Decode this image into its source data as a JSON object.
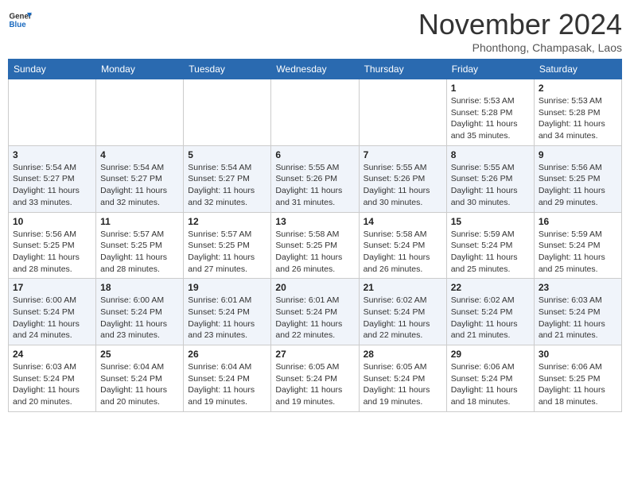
{
  "header": {
    "logo_line1": "General",
    "logo_line2": "Blue",
    "month": "November 2024",
    "location": "Phonthong, Champasak, Laos"
  },
  "days_of_week": [
    "Sunday",
    "Monday",
    "Tuesday",
    "Wednesday",
    "Thursday",
    "Friday",
    "Saturday"
  ],
  "weeks": [
    [
      {
        "day": "",
        "info": ""
      },
      {
        "day": "",
        "info": ""
      },
      {
        "day": "",
        "info": ""
      },
      {
        "day": "",
        "info": ""
      },
      {
        "day": "",
        "info": ""
      },
      {
        "day": "1",
        "info": "Sunrise: 5:53 AM\nSunset: 5:28 PM\nDaylight: 11 hours\nand 35 minutes."
      },
      {
        "day": "2",
        "info": "Sunrise: 5:53 AM\nSunset: 5:28 PM\nDaylight: 11 hours\nand 34 minutes."
      }
    ],
    [
      {
        "day": "3",
        "info": "Sunrise: 5:54 AM\nSunset: 5:27 PM\nDaylight: 11 hours\nand 33 minutes."
      },
      {
        "day": "4",
        "info": "Sunrise: 5:54 AM\nSunset: 5:27 PM\nDaylight: 11 hours\nand 32 minutes."
      },
      {
        "day": "5",
        "info": "Sunrise: 5:54 AM\nSunset: 5:27 PM\nDaylight: 11 hours\nand 32 minutes."
      },
      {
        "day": "6",
        "info": "Sunrise: 5:55 AM\nSunset: 5:26 PM\nDaylight: 11 hours\nand 31 minutes."
      },
      {
        "day": "7",
        "info": "Sunrise: 5:55 AM\nSunset: 5:26 PM\nDaylight: 11 hours\nand 30 minutes."
      },
      {
        "day": "8",
        "info": "Sunrise: 5:55 AM\nSunset: 5:26 PM\nDaylight: 11 hours\nand 30 minutes."
      },
      {
        "day": "9",
        "info": "Sunrise: 5:56 AM\nSunset: 5:25 PM\nDaylight: 11 hours\nand 29 minutes."
      }
    ],
    [
      {
        "day": "10",
        "info": "Sunrise: 5:56 AM\nSunset: 5:25 PM\nDaylight: 11 hours\nand 28 minutes."
      },
      {
        "day": "11",
        "info": "Sunrise: 5:57 AM\nSunset: 5:25 PM\nDaylight: 11 hours\nand 28 minutes."
      },
      {
        "day": "12",
        "info": "Sunrise: 5:57 AM\nSunset: 5:25 PM\nDaylight: 11 hours\nand 27 minutes."
      },
      {
        "day": "13",
        "info": "Sunrise: 5:58 AM\nSunset: 5:25 PM\nDaylight: 11 hours\nand 26 minutes."
      },
      {
        "day": "14",
        "info": "Sunrise: 5:58 AM\nSunset: 5:24 PM\nDaylight: 11 hours\nand 26 minutes."
      },
      {
        "day": "15",
        "info": "Sunrise: 5:59 AM\nSunset: 5:24 PM\nDaylight: 11 hours\nand 25 minutes."
      },
      {
        "day": "16",
        "info": "Sunrise: 5:59 AM\nSunset: 5:24 PM\nDaylight: 11 hours\nand 25 minutes."
      }
    ],
    [
      {
        "day": "17",
        "info": "Sunrise: 6:00 AM\nSunset: 5:24 PM\nDaylight: 11 hours\nand 24 minutes."
      },
      {
        "day": "18",
        "info": "Sunrise: 6:00 AM\nSunset: 5:24 PM\nDaylight: 11 hours\nand 23 minutes."
      },
      {
        "day": "19",
        "info": "Sunrise: 6:01 AM\nSunset: 5:24 PM\nDaylight: 11 hours\nand 23 minutes."
      },
      {
        "day": "20",
        "info": "Sunrise: 6:01 AM\nSunset: 5:24 PM\nDaylight: 11 hours\nand 22 minutes."
      },
      {
        "day": "21",
        "info": "Sunrise: 6:02 AM\nSunset: 5:24 PM\nDaylight: 11 hours\nand 22 minutes."
      },
      {
        "day": "22",
        "info": "Sunrise: 6:02 AM\nSunset: 5:24 PM\nDaylight: 11 hours\nand 21 minutes."
      },
      {
        "day": "23",
        "info": "Sunrise: 6:03 AM\nSunset: 5:24 PM\nDaylight: 11 hours\nand 21 minutes."
      }
    ],
    [
      {
        "day": "24",
        "info": "Sunrise: 6:03 AM\nSunset: 5:24 PM\nDaylight: 11 hours\nand 20 minutes."
      },
      {
        "day": "25",
        "info": "Sunrise: 6:04 AM\nSunset: 5:24 PM\nDaylight: 11 hours\nand 20 minutes."
      },
      {
        "day": "26",
        "info": "Sunrise: 6:04 AM\nSunset: 5:24 PM\nDaylight: 11 hours\nand 19 minutes."
      },
      {
        "day": "27",
        "info": "Sunrise: 6:05 AM\nSunset: 5:24 PM\nDaylight: 11 hours\nand 19 minutes."
      },
      {
        "day": "28",
        "info": "Sunrise: 6:05 AM\nSunset: 5:24 PM\nDaylight: 11 hours\nand 19 minutes."
      },
      {
        "day": "29",
        "info": "Sunrise: 6:06 AM\nSunset: 5:24 PM\nDaylight: 11 hours\nand 18 minutes."
      },
      {
        "day": "30",
        "info": "Sunrise: 6:06 AM\nSunset: 5:25 PM\nDaylight: 11 hours\nand 18 minutes."
      }
    ]
  ]
}
